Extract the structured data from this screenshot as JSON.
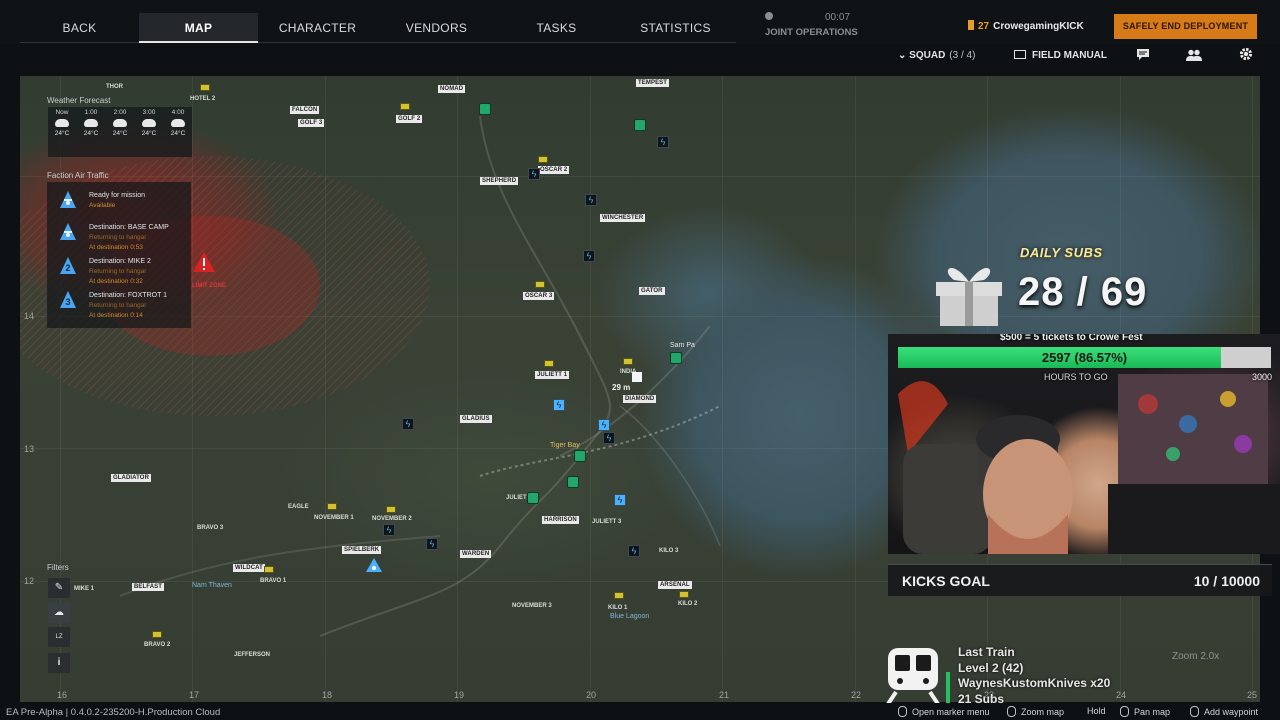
{
  "nav": {
    "tabs": [
      {
        "label": "BACK"
      },
      {
        "label": "MAP"
      },
      {
        "label": "CHARACTER"
      },
      {
        "label": "VENDORS"
      },
      {
        "label": "TASKS"
      },
      {
        "label": "STATISTICS"
      }
    ],
    "active_tab": "MAP",
    "joint_operations": {
      "label": "JOINT OPERATIONS",
      "time": "00:07"
    },
    "player": {
      "level": "27",
      "name": "CrowegamingKICK"
    },
    "end_button": "SAFELY END DEPLOYMENT",
    "squad": {
      "label": "SQUAD",
      "count": "(3 / 4)"
    },
    "field_manual": "FIELD MANUAL"
  },
  "colors": {
    "accent": "#d77a18",
    "map_marker_green": "#23a66b",
    "map_marker_blue": "#48b2ff",
    "danger_zone": "#be1e1e",
    "goal_green": "#1ab957"
  },
  "weather": {
    "title": "Weather Forecast",
    "hours": [
      {
        "time": "Now",
        "temp": "24°C",
        "icon": "cloud-icon"
      },
      {
        "time": "1:00",
        "temp": "24°C",
        "icon": "rain-cloud-icon"
      },
      {
        "time": "2:00",
        "temp": "24°C",
        "icon": "cloud-icon"
      },
      {
        "time": "3:00",
        "temp": "24°C",
        "icon": "cloud-icon"
      },
      {
        "time": "4:00",
        "temp": "24°C",
        "icon": "cloud-icon"
      }
    ]
  },
  "air_traffic": {
    "title": "Faction Air Traffic",
    "items": [
      {
        "destination": "Ready for mission",
        "status1": "Available",
        "status2": "",
        "badge": ""
      },
      {
        "destination": "Destination: BASE CAMP",
        "status1": "Returning to hangar",
        "status2": "At destination 0:53",
        "badge": ""
      },
      {
        "destination": "Destination: MIKE 2",
        "status1": "Returning to hangar",
        "status2": "At destination 0:32",
        "badge": "2"
      },
      {
        "destination": "Destination: FOXTROT 1",
        "status1": "Returning to hangar",
        "status2": "At destination 0:14",
        "badge": "3"
      }
    ]
  },
  "map": {
    "danger_label": "LIMIT ZONE",
    "distance": "29 m",
    "locations": [
      "THOR",
      "HOTEL 2",
      "FALCON",
      "GOLF 3",
      "GOLF 2",
      "NOMAD",
      "TEMPEST",
      "SHEPHERD",
      "OSCAR 2",
      "WINCHESTER",
      "GATOR",
      "OSCAR 3",
      "INDIA",
      "DIAMOND",
      "JULIETT 1",
      "GLADIUS",
      "GLADIATOR",
      "EAGLE",
      "NOVEMBER 1",
      "NOVEMBER 2",
      "BRAVO 3",
      "SPIELBERK",
      "WARDEN",
      "WILDCAT",
      "BRAVO 1",
      "MIKE 1",
      "BELFAST",
      "BRAVO 2",
      "JEFFERSON",
      "JULIET",
      "HARRISON",
      "JULIETT 3",
      "ARSENAL",
      "KILO 3",
      "KILO 1",
      "KILO 2",
      "NOVEMBER 3"
    ],
    "towns": [
      "Tiger Bay",
      "Nam Thaven",
      "Blue Lagoon",
      "Sam Pa"
    ],
    "x_coords": [
      "16",
      "17",
      "18",
      "19",
      "20",
      "21",
      "22",
      "23",
      "24",
      "25"
    ],
    "y_coords": [
      "14",
      "13",
      "12"
    ]
  },
  "filters": {
    "title": "Filters"
  },
  "overlay": {
    "daily_subs_title": "DAILY SUBS",
    "daily_subs_value": "28 / 69",
    "goal_caption": "$500 = 5 tickets to Crowe Fest",
    "goal_value": "2597 (86.57%)",
    "goal_fraction": 0.8657,
    "goal_sub": "HOURS TO GO",
    "goal_max": "3000",
    "kicks_label": "KICKS GOAL",
    "kicks_value": "10 / 10000",
    "train_title": "Last Train",
    "train_level": "Level 2  (42)",
    "train_user": "WaynesKustomKnives x20",
    "train_subs": "21 Subs",
    "zoom": "Zoom 2.0x"
  },
  "footer": {
    "build": "EA Pre-Alpha | 0.4.0.2-235200-H.Production Cloud",
    "hints": [
      {
        "label": "Open marker menu"
      },
      {
        "label": "Zoom map"
      },
      {
        "label": "Hold"
      },
      {
        "label": "Pan map"
      },
      {
        "label": "Add waypoint"
      }
    ]
  }
}
